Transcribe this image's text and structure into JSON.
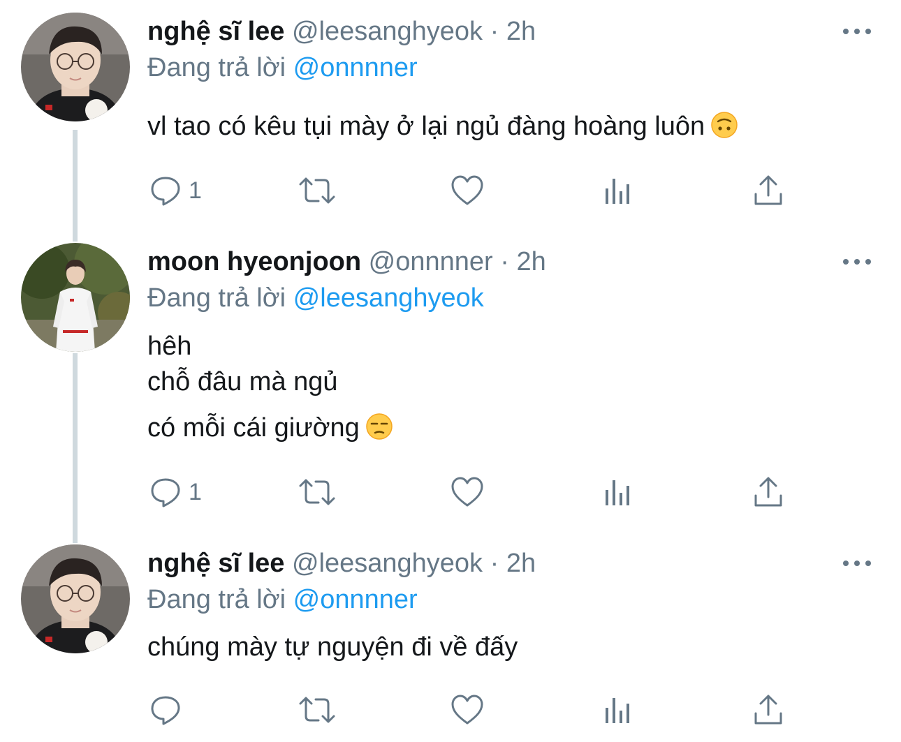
{
  "tweets": [
    {
      "display_name": "nghệ sĩ lee",
      "handle": "@leesanghyeok",
      "separator": "·",
      "time": "2h",
      "reply_prefix": "Đang trả lời",
      "reply_to": "@onnnner",
      "text_lines": [
        "vl tao có kêu tụi mày ở lại ngủ đàng hoàng luôn"
      ],
      "emoji": "upside-down-face",
      "reply_count": "1",
      "avatar": "avatar-leesanghyeok"
    },
    {
      "display_name": "moon hyeonjoon",
      "handle": "@onnnner",
      "separator": "·",
      "time": "2h",
      "reply_prefix": "Đang trả lời",
      "reply_to": "@leesanghyeok",
      "text_lines": [
        "hêh",
        "chỗ đâu mà ngủ",
        "có mỗi cái giường"
      ],
      "emoji": "unamused-face",
      "reply_count": "1",
      "avatar": "avatar-onnnner"
    },
    {
      "display_name": "nghệ sĩ lee",
      "handle": "@leesanghyeok",
      "separator": "·",
      "time": "2h",
      "reply_prefix": "Đang trả lời",
      "reply_to": "@onnnner",
      "text_lines": [
        "chúng mày tự nguyện đi về đấy"
      ],
      "emoji": "",
      "reply_count": "",
      "avatar": "avatar-leesanghyeok"
    }
  ],
  "colors": {
    "text": "#14171a",
    "muted": "#657786",
    "link": "#1d9bf0",
    "thread_line": "#cfd9de"
  },
  "icons": [
    "reply-icon",
    "retweet-icon",
    "like-icon",
    "analytics-icon",
    "share-icon",
    "more-options-icon"
  ]
}
